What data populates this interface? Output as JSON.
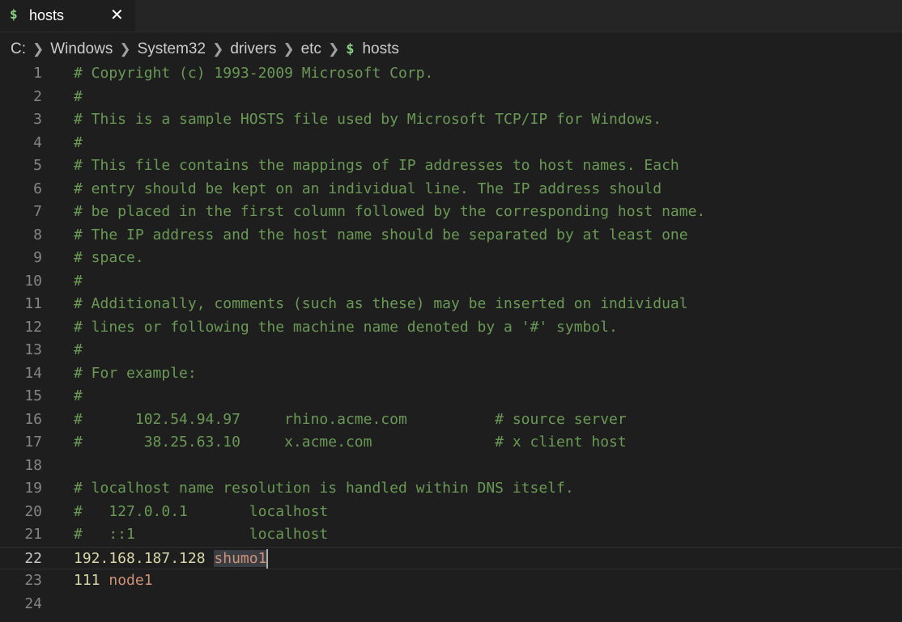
{
  "tab": {
    "icon": "$",
    "label": "hosts",
    "close": "✕"
  },
  "breadcrumb": {
    "items": [
      "C:",
      "Windows",
      "System32",
      "drivers",
      "etc"
    ],
    "file_icon": "$",
    "file": "hosts"
  },
  "editor": {
    "lines": [
      {
        "n": "1",
        "text": "# Copyright (c) 1993-2009 Microsoft Corp."
      },
      {
        "n": "2",
        "text": "#"
      },
      {
        "n": "3",
        "text": "# This is a sample HOSTS file used by Microsoft TCP/IP for Windows."
      },
      {
        "n": "4",
        "text": "#"
      },
      {
        "n": "5",
        "text": "# This file contains the mappings of IP addresses to host names. Each"
      },
      {
        "n": "6",
        "text": "# entry should be kept on an individual line. The IP address should"
      },
      {
        "n": "7",
        "text": "# be placed in the first column followed by the corresponding host name."
      },
      {
        "n": "8",
        "text": "# The IP address and the host name should be separated by at least one"
      },
      {
        "n": "9",
        "text": "# space."
      },
      {
        "n": "10",
        "text": "#"
      },
      {
        "n": "11",
        "text": "# Additionally, comments (such as these) may be inserted on individual"
      },
      {
        "n": "12",
        "text": "# lines or following the machine name denoted by a '#' symbol."
      },
      {
        "n": "13",
        "text": "#"
      },
      {
        "n": "14",
        "text": "# For example:"
      },
      {
        "n": "15",
        "text": "#"
      },
      {
        "n": "16",
        "text": "#      102.54.94.97     rhino.acme.com          # source server"
      },
      {
        "n": "17",
        "text": "#       38.25.63.10     x.acme.com              # x client host"
      },
      {
        "n": "18",
        "text": ""
      },
      {
        "n": "19",
        "text": "# localhost name resolution is handled within DNS itself."
      },
      {
        "n": "20",
        "text": "#   127.0.0.1       localhost"
      },
      {
        "n": "21",
        "text": "#   ::1             localhost"
      },
      {
        "n": "22",
        "ip": "192.168.187.128",
        "host": "shumo1"
      },
      {
        "n": "23",
        "ip": "111",
        "host": "node1"
      },
      {
        "n": "24",
        "text": ""
      }
    ]
  },
  "colors": {
    "background": "#1e1e1e",
    "comment": "#6a9955",
    "ip": "#d7d7a8",
    "host": "#ce9178",
    "line_number": "#858585"
  }
}
